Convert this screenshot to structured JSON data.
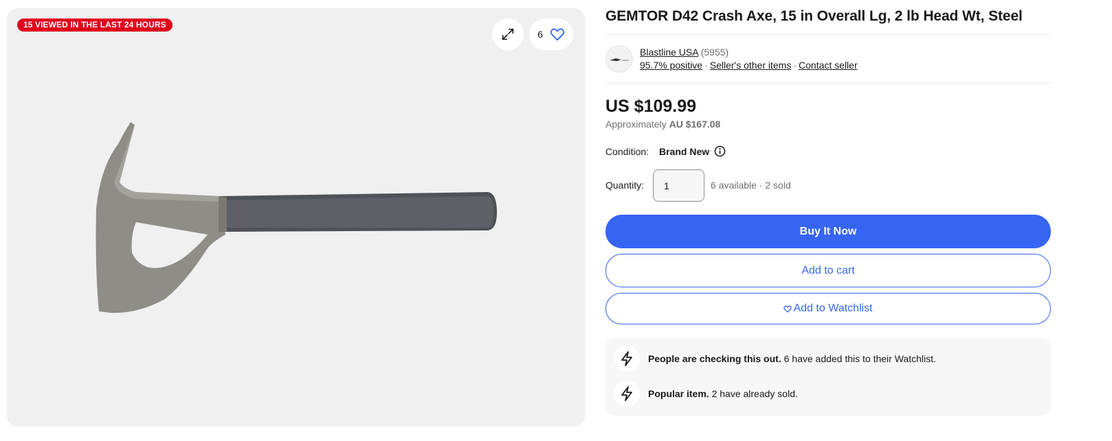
{
  "gallery": {
    "badge": "15 VIEWED IN THE LAST 24 HOURS",
    "watch_count": "6",
    "icons": [
      "expand-icon",
      "heart-icon"
    ]
  },
  "product": {
    "title": "GEMTOR D42 Crash Axe, 15 in Overall Lg, 2 lb Head Wt, Steel"
  },
  "seller": {
    "name": "Blastline USA",
    "feedback_count": "(5955)",
    "positive": "95.7% positive",
    "other_items": "Seller's other items",
    "contact": "Contact seller"
  },
  "pricing": {
    "price": "US $109.99",
    "approx_prefix": "Approximately",
    "approx_value": "AU $167.08"
  },
  "condition": {
    "label": "Condition:",
    "value": "Brand New"
  },
  "quantity": {
    "label": "Quantity:",
    "value": "1",
    "available": "6 available · 2 sold"
  },
  "buttons": {
    "buy_now": "Buy It Now",
    "add_to_cart": "Add to cart",
    "add_to_watchlist": "Add to Watchlist"
  },
  "signals": [
    {
      "bold": "People are checking this out.",
      "text": " 6 have added this to their Watchlist.",
      "icon": "lightning-icon"
    },
    {
      "bold": "Popular item.",
      "text": " 2 have already sold.",
      "icon": "lightning-icon"
    }
  ],
  "colors": {
    "accent": "#3665f3",
    "badge": "#e0001b",
    "muted": "#707070",
    "panel": "#f7f7f7"
  }
}
